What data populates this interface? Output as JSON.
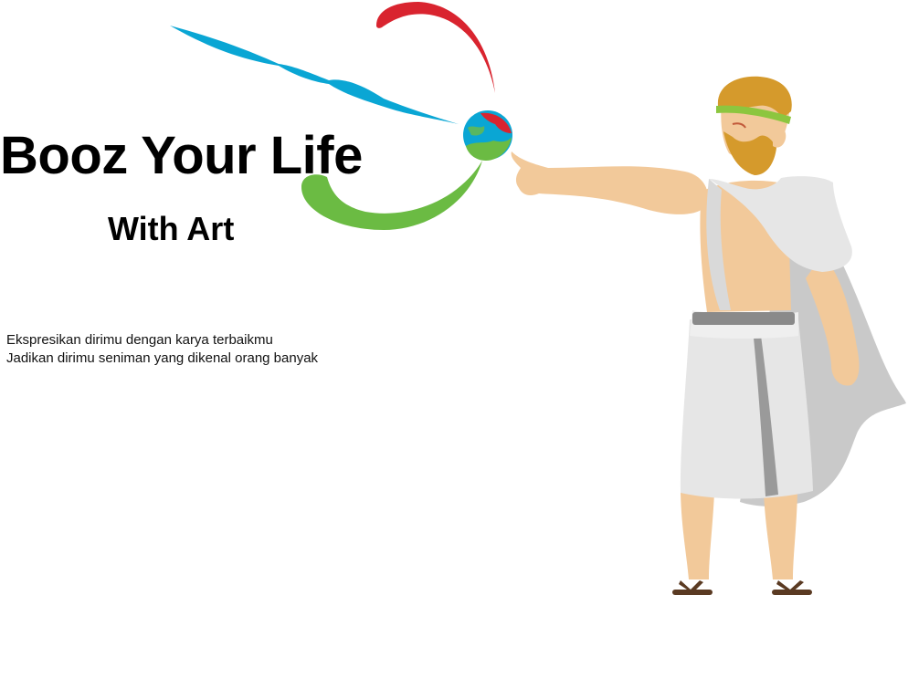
{
  "hero": {
    "title": "Booz Your Life",
    "subtitle": "With Art"
  },
  "tagline": {
    "line1": "Ekspresikan dirimu dengan karya terbaikmu",
    "line2": "Jadikan dirimu seniman yang dikenal orang banyak"
  },
  "colors": {
    "blue": "#0aa6d4",
    "red": "#d9242f",
    "green": "#6bbb43",
    "skin": "#f2c99a",
    "toga": "#e6e6e6",
    "hair": "#d59a2c"
  }
}
